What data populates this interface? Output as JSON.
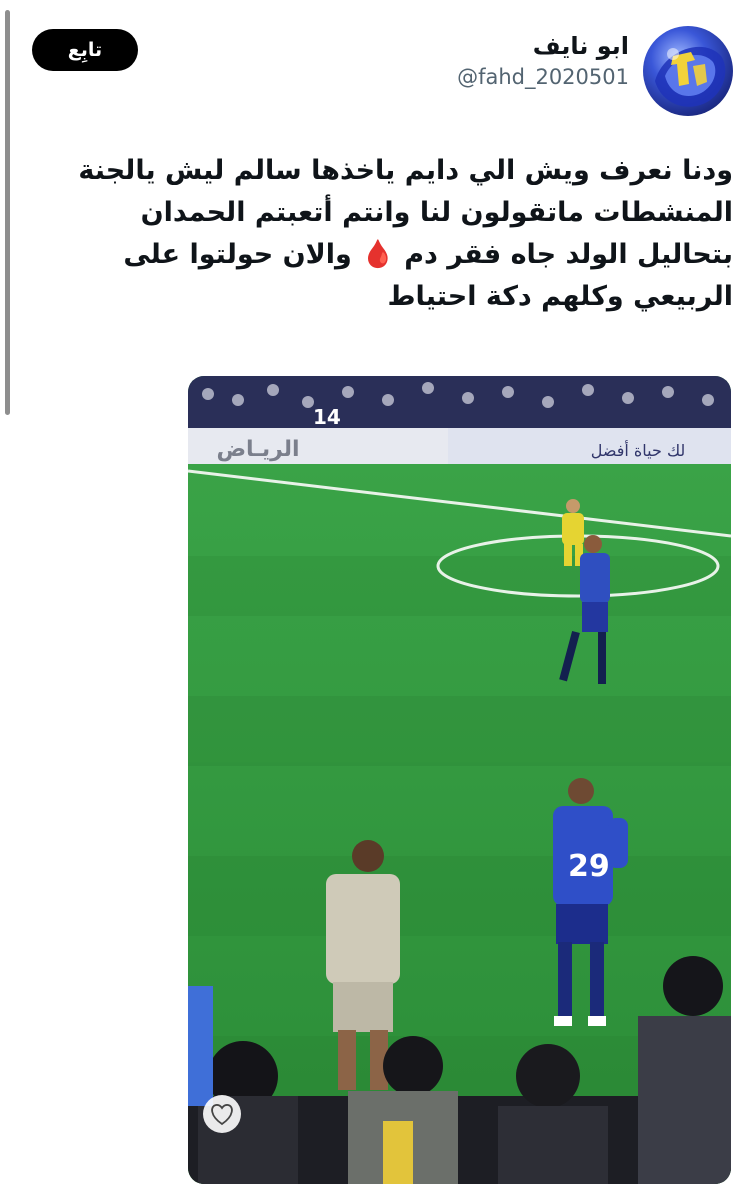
{
  "follow_button": {
    "label": "تابِع"
  },
  "user": {
    "display_name": "ابو نايف",
    "handle": "@fahd_2020501"
  },
  "tweet": {
    "lines": [
      "ودنا نعرف ويش الي دايم ياخذها سالم ليش يالجنة",
      "المنشطات ماتقولون لنا وانتم أتعبتم الحمدان",
      "بتحاليل الولد جاه فقر دم 🩸 والان حولتوا على",
      "الربيعي وكلهم دكة احتياط"
    ]
  },
  "media": {
    "banner_left_text": "الريـاض",
    "banner_right_text": "لك حياة أفضل",
    "jersey_number": "29",
    "stand_number": "14",
    "icons": [
      "heart-icon",
      "blood-drop-icon"
    ]
  }
}
